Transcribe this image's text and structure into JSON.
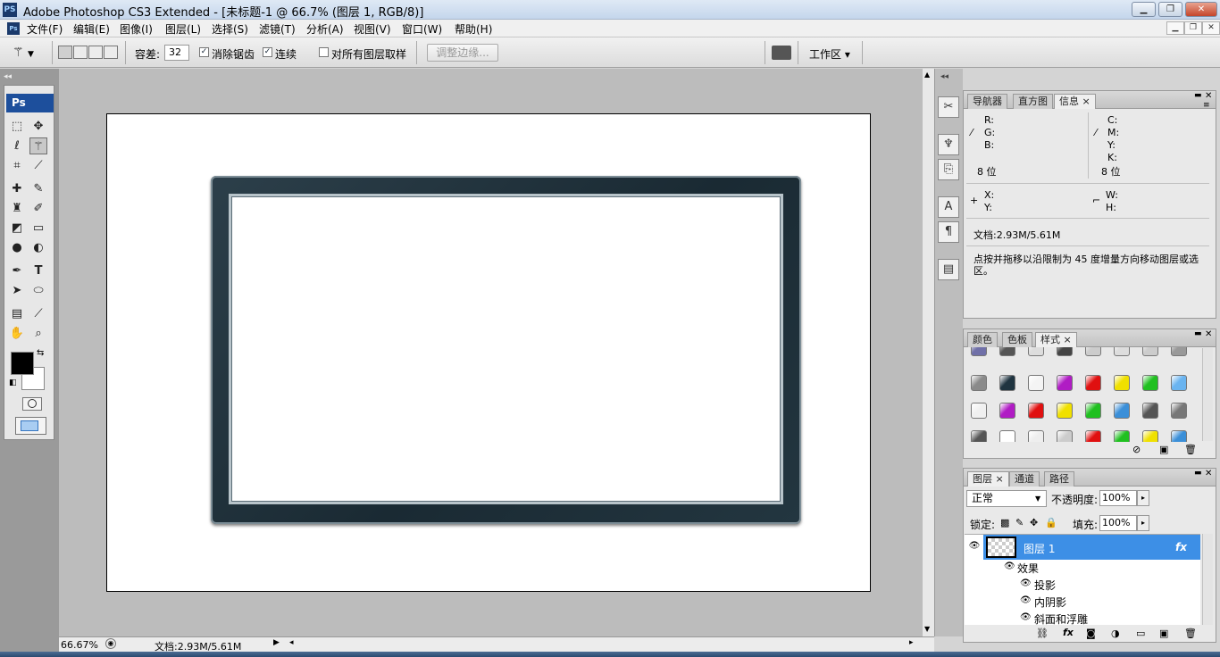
{
  "window": {
    "app_icon": "PS",
    "title": "Adobe Photoshop CS3 Extended - [未标题-1 @ 66.7% (图层 1, RGB/8)]",
    "buttons": [
      "minimize-icon",
      "restore-icon",
      "close-icon"
    ]
  },
  "menu": {
    "items": [
      "文件(F)",
      "编辑(E)",
      "图像(I)",
      "图层(L)",
      "选择(S)",
      "滤镜(T)",
      "分析(A)",
      "视图(V)",
      "窗口(W)",
      "帮助(H)"
    ]
  },
  "options": {
    "tolerance_label": "容差:",
    "tolerance_value": "32",
    "antialias_label": "消除锯齿",
    "antialias_checked": true,
    "contiguous_label": "连续",
    "contiguous_checked": true,
    "all_layers_label": "对所有图层取样",
    "all_layers_checked": false,
    "refine_edge_label": "调整边缘...",
    "workspace_label": "工作区 ▾"
  },
  "toolbox": {
    "badge": "Ps"
  },
  "status": {
    "zoom": "66.67%",
    "doc_size": "文档:2.93M/5.61M"
  },
  "info_panel": {
    "tabs": [
      "导航器",
      "直方图",
      "信息"
    ],
    "active_tab": "信息",
    "rgb_labels": [
      "R:",
      "G:",
      "B:"
    ],
    "cmyk_labels": [
      "C:",
      "M:",
      "Y:",
      "K:"
    ],
    "bits_left": "8 位",
    "bits_right": "8 位",
    "xy_labels": [
      "X:",
      "Y:"
    ],
    "wh_labels": [
      "W:",
      "H:"
    ],
    "doc_size": "文档:2.93M/5.61M",
    "hint": "点按并拖移以沿限制为 45 度增量方向移动图层或选区。"
  },
  "styles_panel": {
    "tabs": [
      "颜色",
      "色板",
      "样式"
    ],
    "active_tab": "样式"
  },
  "layers_panel": {
    "tabs": [
      "图层",
      "通道",
      "路径"
    ],
    "active_tab": "图层",
    "blend_mode": "正常",
    "opacity_label": "不透明度:",
    "opacity_value": "100%",
    "lock_label": "锁定:",
    "fill_label": "填充:",
    "fill_value": "100%",
    "layer_name": "图层 1",
    "fx_badge": "fx",
    "effects_label": "效果",
    "effects": [
      "投影",
      "内阴影",
      "斜面和浮雕"
    ]
  },
  "colors": {
    "accent": "#3d8fe6",
    "frame": "#1f2f38",
    "foreground": "#000000",
    "background": "#ffffff"
  }
}
